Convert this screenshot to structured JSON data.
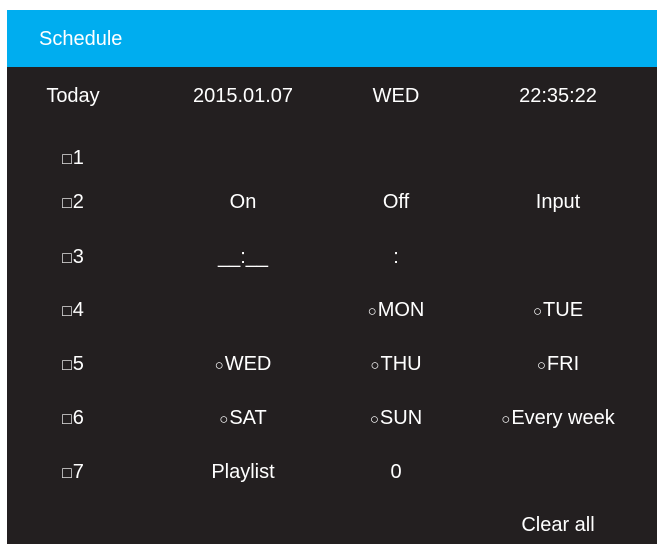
{
  "header": {
    "title": "Schedule"
  },
  "top_row": {
    "label": "Today",
    "date": "2015.01.07",
    "weekday": "WED",
    "time": "22:35:22"
  },
  "schedules": [
    {
      "checkbox_glyph": "□",
      "label": "1"
    },
    {
      "checkbox_glyph": "□",
      "label": "2"
    },
    {
      "checkbox_glyph": "□",
      "label": "3"
    },
    {
      "checkbox_glyph": "□",
      "label": "4"
    },
    {
      "checkbox_glyph": "□",
      "label": "5"
    },
    {
      "checkbox_glyph": "□",
      "label": "6"
    },
    {
      "checkbox_glyph": "□",
      "label": "7"
    }
  ],
  "settings": {
    "on_label": "On",
    "off_label": "Off",
    "input_label": "Input",
    "on_time_value": "__:__",
    "off_time_value": ":",
    "playlist_label": "Playlist",
    "playlist_value": "0",
    "clear_all_label": "Clear all"
  },
  "days": {
    "radio_glyph": "○",
    "mon": "MON",
    "tue": "TUE",
    "wed": "WED",
    "thu": "THU",
    "fri": "FRI",
    "sat": "SAT",
    "sun": "SUN",
    "every_week": "Every week"
  },
  "colors": {
    "header_bg": "#00adef",
    "panel_bg": "#231f20",
    "text": "#ffffff"
  }
}
